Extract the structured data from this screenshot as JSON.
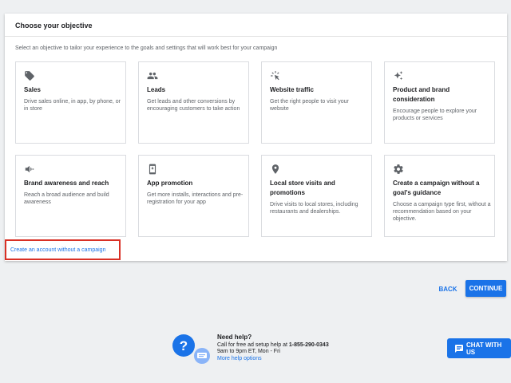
{
  "panel": {
    "title": "Choose your objective",
    "subtitle": "Select an objective to tailor your experience to the goals and settings that will work best for your campaign"
  },
  "objectives": [
    {
      "icon": "tag-icon",
      "title": "Sales",
      "description": "Drive sales online, in app, by phone, or in store"
    },
    {
      "icon": "people-icon",
      "title": "Leads",
      "description": "Get leads and other conversions by encouraging customers to take action"
    },
    {
      "icon": "cursor-click-icon",
      "title": "Website traffic",
      "description": "Get the right people to visit your website"
    },
    {
      "icon": "sparkle-icon",
      "title": "Product and brand consideration",
      "description": "Encourage people to explore your products or services"
    },
    {
      "icon": "megaphone-icon",
      "title": "Brand awareness and reach",
      "description": "Reach a broad audience and build awareness"
    },
    {
      "icon": "phone-download-icon",
      "title": "App promotion",
      "description": "Get more installs, interactions and pre-registration for your app"
    },
    {
      "icon": "location-pin-icon",
      "title": "Local store visits and promotions",
      "description": "Drive visits to local stores, including restaurants and dealerships."
    },
    {
      "icon": "gear-icon",
      "title": "Create a campaign without a goal's guidance",
      "description": "Choose a campaign type first, without a recommendation based on your objective."
    }
  ],
  "no_campaign_link": "Create an account without a campaign",
  "buttons": {
    "back": "BACK",
    "continue": "CONTINUE"
  },
  "help": {
    "title": "Need help?",
    "line1_prefix": "Call for free ad setup help at ",
    "phone": "1-855-290-0343",
    "line2": "9am to 9pm ET, Mon - Fri",
    "link": "More help options"
  },
  "chat": {
    "label": "CHAT WITH US"
  },
  "colors": {
    "accent": "#1a73e8",
    "highlight": "#d93025",
    "background": "#eef0f2"
  }
}
